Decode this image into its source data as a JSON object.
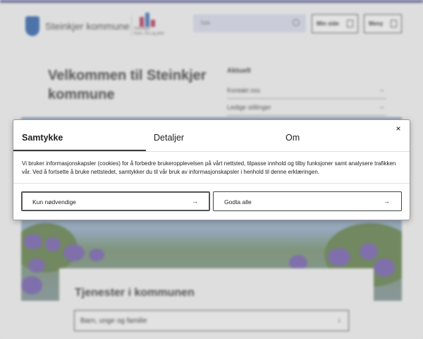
{
  "header": {
    "brand": "Steinkjer kommune",
    "brand_mark_text": "Steinkjer\nfram, fra og jekk",
    "search_placeholder": "Søk",
    "my_page_label": "Min side",
    "menu_label": "Meny"
  },
  "hero": {
    "title": "Velkommen til Steinkjer kommune"
  },
  "news": {
    "title": "Aktuelt",
    "items": [
      "Kontakt oss",
      "Ledige stillinger"
    ]
  },
  "services": {
    "title": "Tjenester i kommunen",
    "items": [
      "Barn, unge og familie"
    ]
  },
  "cookie_dialog": {
    "tabs": [
      {
        "label": "Samtykke",
        "active": true
      },
      {
        "label": "Detaljer",
        "active": false
      },
      {
        "label": "Om",
        "active": false
      }
    ],
    "close_icon": "×",
    "text": "Vi bruker informasjonskapsler (cookies) for å forbedre brukeropplevelsen på vårt nettsted, tilpasse innhold og tilby funksjoner samt analysere trafikken vår. Ved å fortsette å bruke nettstedet, samtykker du til vår bruk av informasjonskapsler i henhold til denne erklæringen.",
    "buttons": {
      "necessary": "Kun nødvendige",
      "accept_all": "Godta alle"
    }
  },
  "icons": {
    "arrow_right": "→",
    "arrow_down": "↓"
  },
  "colors": {
    "topbar": "#555b91",
    "shield": "#2a5fa8",
    "search_bg": "#d3d5e6"
  }
}
